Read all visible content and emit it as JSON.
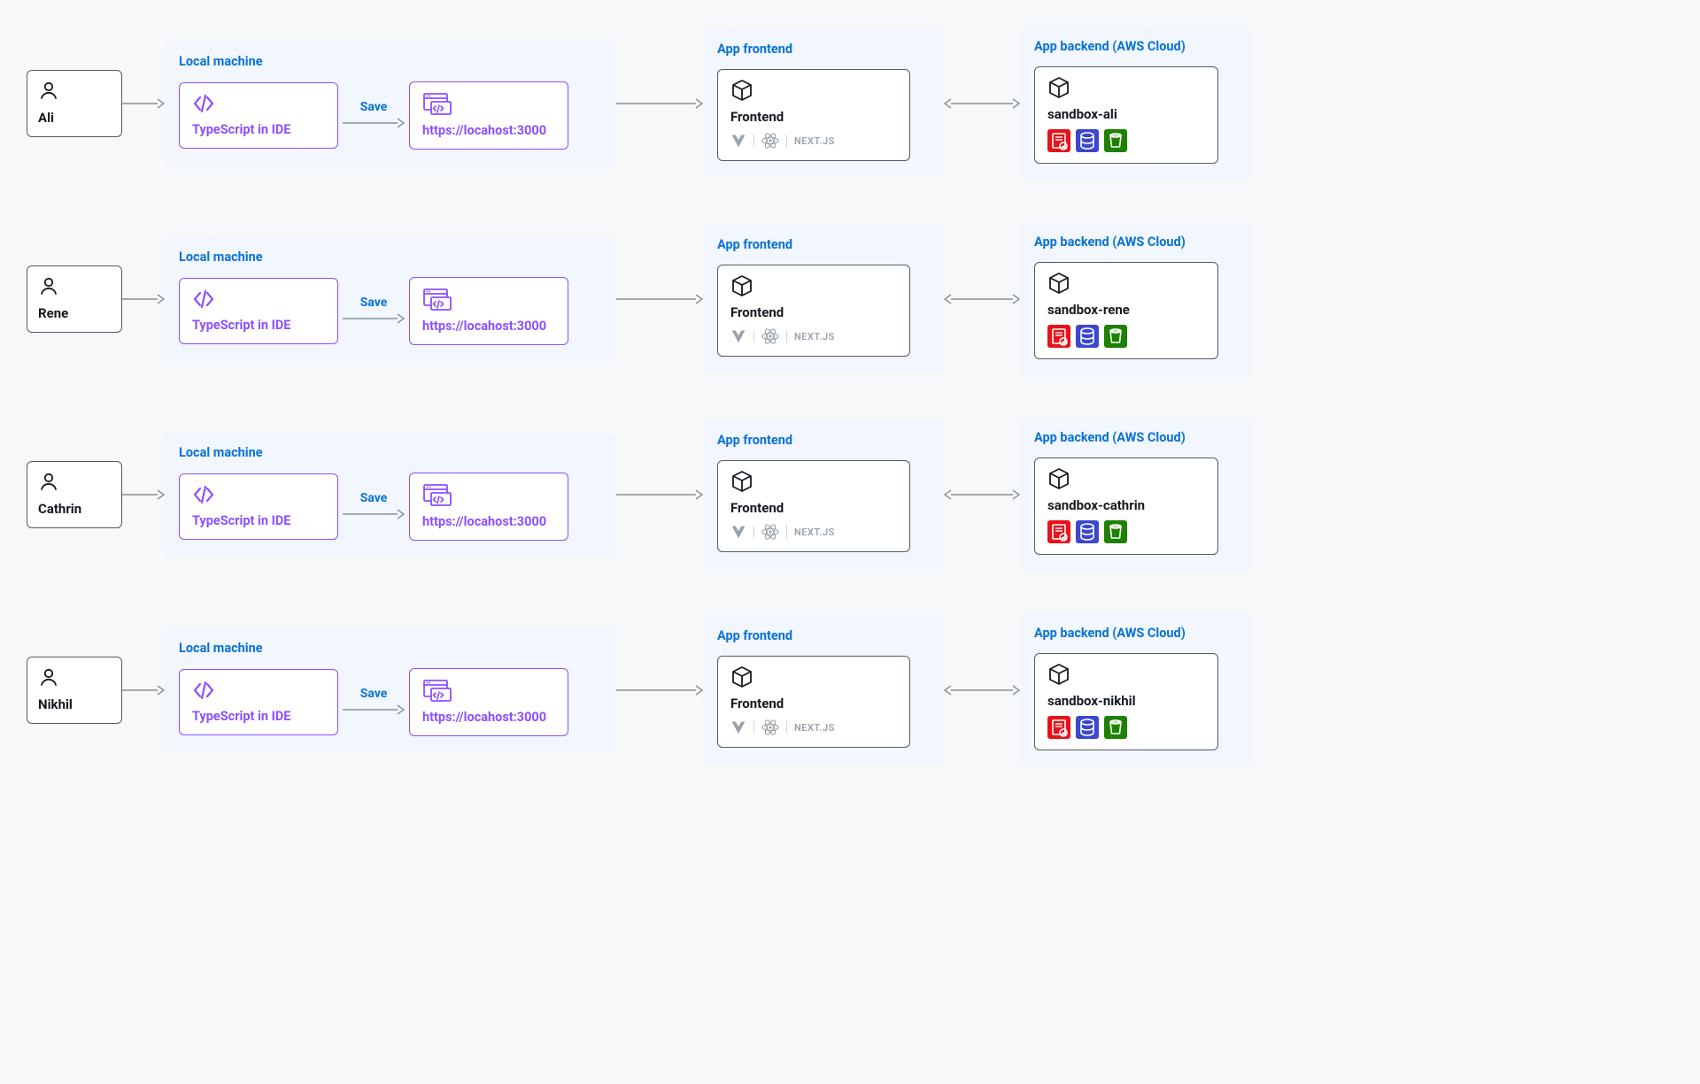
{
  "labels": {
    "local": "Local machine",
    "frontend_group": "App frontend",
    "backend_group": "App backend (AWS Cloud)",
    "ide": "TypeScript in IDE",
    "host": "https://locahost:3000",
    "save": "Save",
    "frontend": "Frontend",
    "next": "NEXT.JS"
  },
  "rows": [
    {
      "user": "Ali",
      "sandbox": "sandbox-ali"
    },
    {
      "user": "Rene",
      "sandbox": "sandbox-rene"
    },
    {
      "user": "Cathrin",
      "sandbox": "sandbox-cathrin"
    },
    {
      "user": "Nikhil",
      "sandbox": "sandbox-nikhil"
    }
  ]
}
